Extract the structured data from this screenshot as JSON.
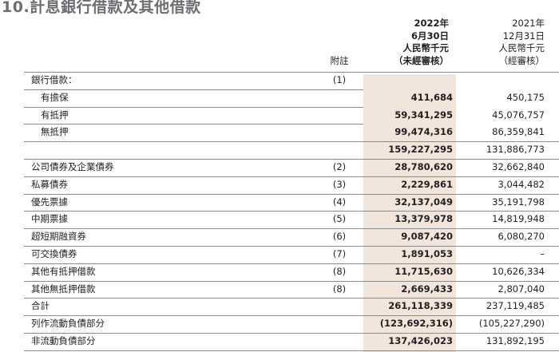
{
  "title": "10.計息銀行借款及其他借款",
  "header": {
    "note_label": "附註",
    "col_2022": [
      "2022年",
      "6月30日",
      "人民幣千元",
      "（未經審核）"
    ],
    "col_2021": [
      "2021年",
      "12月31日",
      "人民幣千元",
      "（經審核）"
    ]
  },
  "rows": [
    {
      "label": "銀行借款：",
      "note": "(1)",
      "v2022": "",
      "v2021": ""
    },
    {
      "label": "有擔保",
      "note": "",
      "v2022": "411,684",
      "v2021": "450,175"
    },
    {
      "label": "有抵押",
      "note": "",
      "v2022": "59,341,295",
      "v2021": "45,076,757"
    },
    {
      "label": "無抵押",
      "note": "",
      "v2022": "99,474,316",
      "v2021": "86,359,841"
    },
    {
      "label": "",
      "note": "",
      "v2022": "159,227,295",
      "v2021": "131,886,773"
    },
    {
      "label": "公司債券及企業債券",
      "note": "(2)",
      "v2022": "28,780,620",
      "v2021": "32,662,840"
    },
    {
      "label": "私募債券",
      "note": "(3)",
      "v2022": "2,229,861",
      "v2021": "3,044,482"
    },
    {
      "label": "優先票據",
      "note": "(4)",
      "v2022": "32,137,049",
      "v2021": "35,191,798"
    },
    {
      "label": "中期票據",
      "note": "(5)",
      "v2022": "13,379,978",
      "v2021": "14,819,948"
    },
    {
      "label": "超短期融資券",
      "note": "(6)",
      "v2022": "9,087,420",
      "v2021": "6,080,270"
    },
    {
      "label": "可交換債券",
      "note": "(7)",
      "v2022": "1,891,053",
      "v2021": "–"
    },
    {
      "label": "其他有抵押借款",
      "note": "(8)",
      "v2022": "11,715,630",
      "v2021": "10,626,334"
    },
    {
      "label": "其他無抵押借款",
      "note": "(8)",
      "v2022": "2,669,433",
      "v2021": "2,807,040"
    },
    {
      "label": "合計",
      "note": "",
      "v2022": "261,118,339",
      "v2021": "237,119,485"
    },
    {
      "label": "列作流動負債部分",
      "note": "",
      "v2022": "(123,692,316)",
      "v2021": "(105,227,290)"
    },
    {
      "label": "非流動負債部分",
      "note": "",
      "v2022": "137,426,023",
      "v2021": "131,892,195"
    }
  ]
}
